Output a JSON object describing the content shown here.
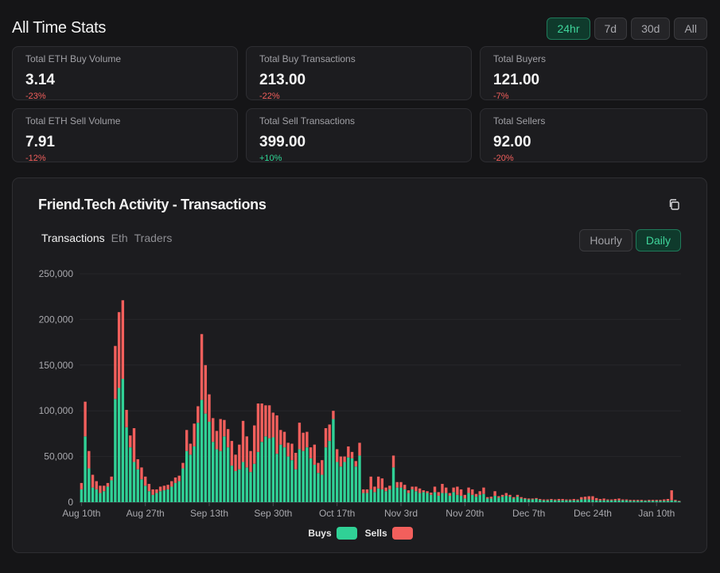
{
  "header": {
    "title": "All Time Stats",
    "ranges": [
      {
        "label": "24hr",
        "active": true
      },
      {
        "label": "7d",
        "active": false
      },
      {
        "label": "30d",
        "active": false
      },
      {
        "label": "All",
        "active": false
      }
    ]
  },
  "stats": [
    {
      "label": "Total ETH Buy Volume",
      "value": "3.14",
      "change": "-23%",
      "trend": "down"
    },
    {
      "label": "Total Buy Transactions",
      "value": "213.00",
      "change": "-22%",
      "trend": "down"
    },
    {
      "label": "Total Buyers",
      "value": "121.00",
      "change": "-7%",
      "trend": "down"
    },
    {
      "label": "Total ETH Sell Volume",
      "value": "7.91",
      "change": "-12%",
      "trend": "down"
    },
    {
      "label": "Total Sell Transactions",
      "value": "399.00",
      "change": "+10%",
      "trend": "up"
    },
    {
      "label": "Total Sellers",
      "value": "92.00",
      "change": "-20%",
      "trend": "down"
    }
  ],
  "colors": {
    "up": "#2fd796",
    "down": "#f25f5c",
    "buys": "#30d196",
    "sells": "#f25f5c"
  },
  "panel": {
    "title": "Friend.Tech Activity - Transactions",
    "copy_icon": "copy-icon",
    "metric_tabs": [
      {
        "label": "Transactions",
        "active": true
      },
      {
        "label": "Eth",
        "active": false
      },
      {
        "label": "Traders",
        "active": false
      }
    ],
    "granularity_tabs": [
      {
        "label": "Hourly",
        "active": false
      },
      {
        "label": "Daily",
        "active": true
      }
    ]
  },
  "chart_data": {
    "type": "bar",
    "stacked": true,
    "x_start": "2023-08-10",
    "interval_days": 1,
    "x_tick_labels": [
      "Aug 10th",
      "Aug 27th",
      "Sep 13th",
      "Sep 30th",
      "Oct 17th",
      "Nov 3rd",
      "Nov 20th",
      "Dec 7th",
      "Dec 24th",
      "Jan 10th"
    ],
    "y_tick_labels": [
      "0",
      "50,000",
      "100,000",
      "150,000",
      "200,000",
      "250,000"
    ],
    "ylim": [
      0,
      250000
    ],
    "legend": "bottom",
    "series": [
      {
        "name": "Buys",
        "values": [
          14000,
          72000,
          37000,
          16000,
          14000,
          10000,
          12000,
          17000,
          24000,
          113000,
          125000,
          135000,
          82000,
          60000,
          44000,
          36000,
          25000,
          18000,
          12000,
          8000,
          10000,
          12000,
          13000,
          14000,
          17000,
          21000,
          23000,
          37000,
          56000,
          52000,
          61000,
          87000,
          112000,
          97000,
          88000,
          66000,
          58000,
          56000,
          72000,
          60000,
          40000,
          34000,
          36000,
          44000,
          38000,
          33000,
          42000,
          55000,
          66000,
          72000,
          70000,
          71000,
          53000,
          63000,
          60000,
          50000,
          46000,
          36000,
          58000,
          56000,
          60000,
          48000,
          41000,
          32000,
          30000,
          60000,
          67000,
          91000,
          44000,
          39000,
          44000,
          49000,
          48000,
          39000,
          51000,
          10000,
          10000,
          14000,
          11000,
          15000,
          14000,
          12000,
          14000,
          38000,
          16000,
          16000,
          14000,
          10000,
          14000,
          12000,
          10000,
          11000,
          10000,
          8000,
          11000,
          7000,
          10000,
          10000,
          7000,
          11000,
          8000,
          7000,
          4000,
          10000,
          8000,
          6000,
          8000,
          9000,
          4000,
          4000,
          7000,
          5000,
          6000,
          7000,
          6000,
          4000,
          6000,
          4000,
          3500,
          3000,
          3000,
          3500,
          2500,
          2000,
          2000,
          2500,
          2000,
          2000,
          2000,
          2000,
          2000,
          2000,
          2000,
          3000,
          3000,
          3000,
          2500,
          2000,
          2000,
          2000,
          2000,
          2000,
          2000,
          2000,
          2000,
          2000,
          1500,
          1500,
          1500,
          1500,
          1500,
          1500,
          1500,
          1500,
          1500,
          1500,
          1500,
          2000,
          1500,
          1000
        ]
      },
      {
        "name": "Sells",
        "values": [
          7000,
          38000,
          19000,
          14000,
          9000,
          8000,
          6000,
          4000,
          4000,
          58000,
          83000,
          86000,
          19000,
          13000,
          37000,
          11000,
          13000,
          10000,
          8000,
          6000,
          4000,
          5000,
          5000,
          5000,
          6000,
          6000,
          6000,
          6000,
          23000,
          12000,
          25000,
          18000,
          72000,
          53000,
          30000,
          26000,
          20000,
          35000,
          18000,
          20000,
          27000,
          18000,
          27000,
          45000,
          34000,
          23000,
          42000,
          53000,
          42000,
          34000,
          36000,
          27000,
          42000,
          16000,
          17000,
          15000,
          18000,
          18000,
          29000,
          20000,
          17000,
          12000,
          22000,
          11000,
          16000,
          21000,
          18000,
          9000,
          14000,
          11000,
          6000,
          12000,
          7000,
          6000,
          14000,
          4000,
          4000,
          14000,
          6000,
          13000,
          12000,
          4000,
          4000,
          13000,
          6000,
          6000,
          5000,
          3000,
          3000,
          5000,
          5000,
          2000,
          2000,
          2500,
          6000,
          4000,
          10000,
          6000,
          3000,
          5000,
          9000,
          7000,
          4000,
          6000,
          6000,
          3000,
          4000,
          7000,
          1500,
          2000,
          5000,
          1500,
          2000,
          3000,
          2000,
          1500,
          2000,
          1500,
          1000,
          1000,
          1000,
          1000,
          1000,
          1000,
          1000,
          1000,
          1000,
          1500,
          1500,
          1000,
          1000,
          1500,
          1000,
          2500,
          3000,
          3500,
          4000,
          2500,
          1500,
          2000,
          1000,
          1000,
          1500,
          2000,
          1000,
          1000,
          1000,
          1000,
          1000,
          1000,
          500,
          1000,
          1000,
          1000,
          1000,
          1500,
          2000,
          11000,
          1000,
          500
        ]
      }
    ]
  }
}
